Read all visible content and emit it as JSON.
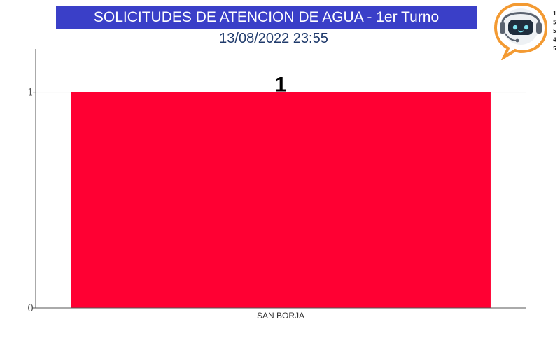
{
  "header": {
    "title": "SOLICITUDES DE ATENCION DE AGUA - 1er Turno",
    "datetime": "13/08/2022 23:55"
  },
  "logo": {
    "icon": "robot-headset-icon",
    "side_numbers": [
      "1",
      "5",
      "5",
      "4",
      "5"
    ]
  },
  "chart_data": {
    "type": "bar",
    "title": "SOLICITUDES DE ATENCION DE AGUA - 1er Turno",
    "subtitle": "13/08/2022 23:55",
    "categories": [
      "SAN BORJA"
    ],
    "values": [
      1
    ],
    "data_labels": [
      "1"
    ],
    "xlabel": "",
    "ylabel": "",
    "ylim": [
      0,
      1.2
    ],
    "yticks": [
      0,
      1
    ],
    "grid": true,
    "legend": "none",
    "colors": {
      "bar": "#ff0033",
      "banner": "#3a3fc8",
      "grid": "#dddddd",
      "axis": "#555555"
    }
  }
}
